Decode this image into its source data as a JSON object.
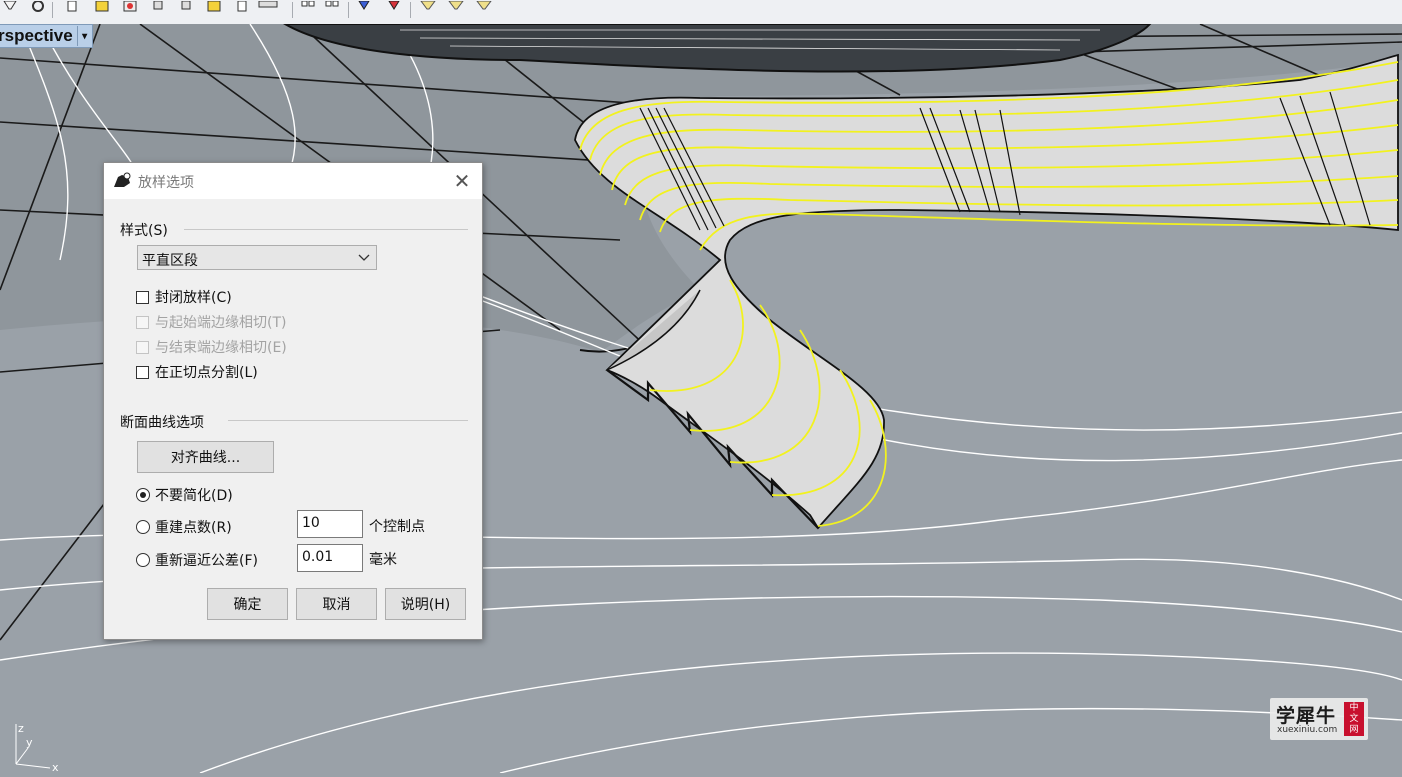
{
  "viewport": {
    "name": "rspective",
    "menu_arrow": "▾"
  },
  "dialog": {
    "title": "放样选项",
    "close_glyph": "✕",
    "style_group": {
      "label": "样式(S)",
      "selected": "平直区段"
    },
    "checkboxes": [
      {
        "label": "封闭放样(C)",
        "checked": false,
        "enabled": true
      },
      {
        "label": "与起始端边缘相切(T)",
        "checked": false,
        "enabled": false
      },
      {
        "label": "与结束端边缘相切(E)",
        "checked": false,
        "enabled": false
      },
      {
        "label": "在正切点分割(L)",
        "checked": false,
        "enabled": true
      }
    ],
    "section_group": {
      "label": "断面曲线选项",
      "align_button": "对齐曲线..."
    },
    "radios": [
      {
        "label": "不要简化(D)",
        "selected": true
      },
      {
        "label": "重建点数(R)",
        "selected": false,
        "value": "10",
        "unit": "个控制点"
      },
      {
        "label": "重新逼近公差(F)",
        "selected": false,
        "value": "0.01",
        "unit": "毫米"
      }
    ],
    "buttons": {
      "ok": "确定",
      "cancel": "取消",
      "help": "说明(H)"
    }
  },
  "axis": {
    "x": "x",
    "y": "y",
    "z": "z"
  },
  "watermark": {
    "main": "学犀牛",
    "sub": "xuexiniu.com",
    "badge": [
      "中",
      "文",
      "网"
    ]
  },
  "colors": {
    "viewport_bg": "#9aa1a8",
    "highlight_yellow": "#f2f21e",
    "tab_bg": "#b9cfe8"
  }
}
